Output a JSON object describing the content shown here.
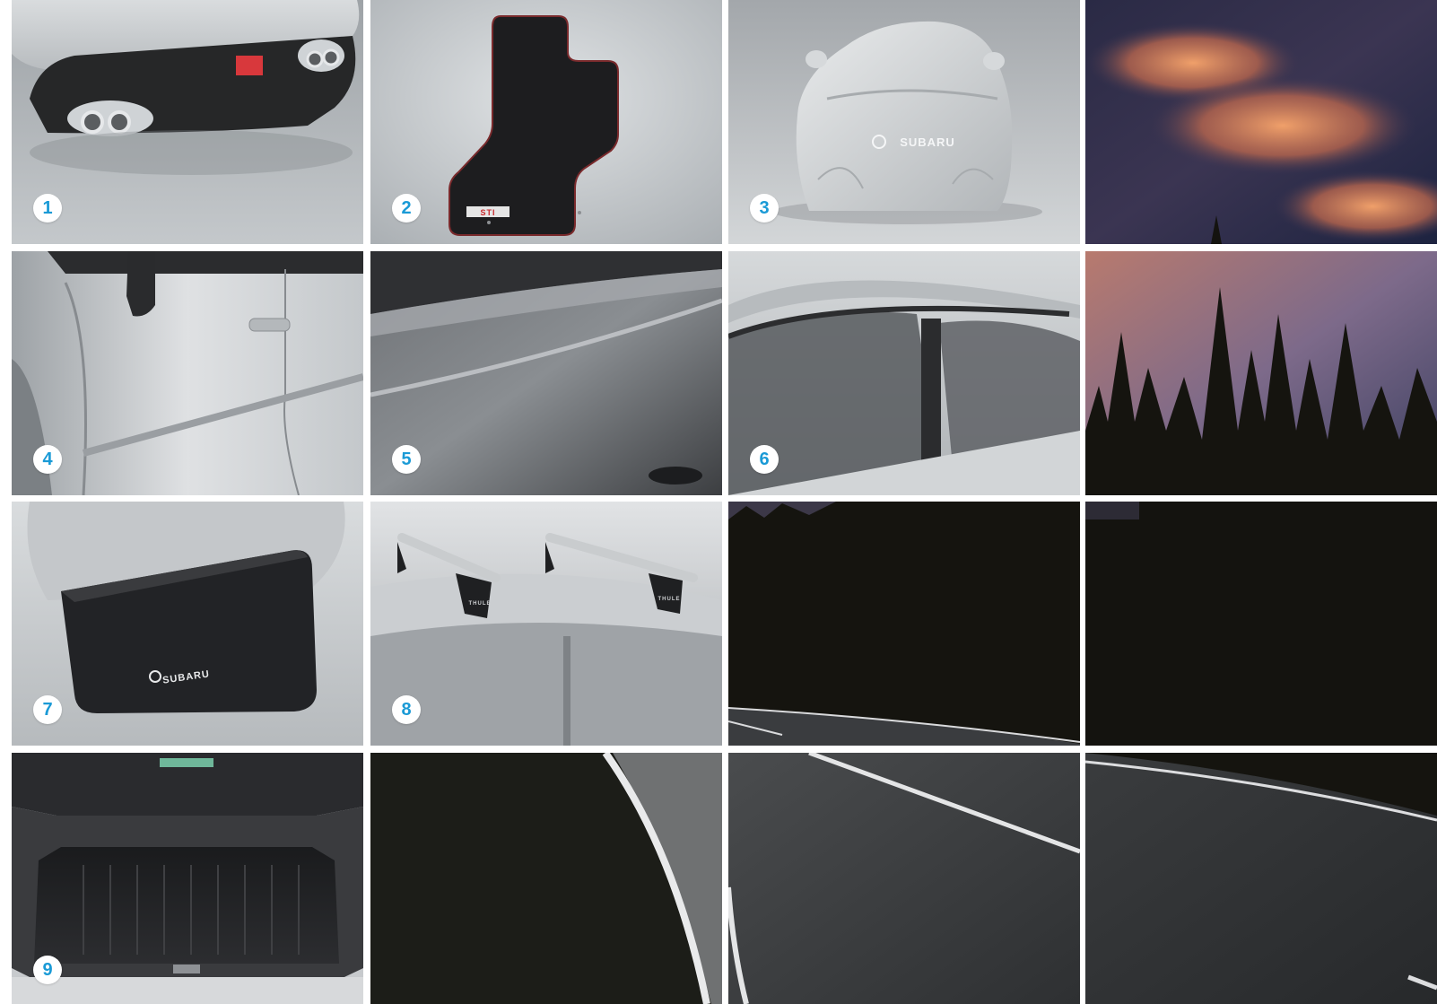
{
  "brand": {
    "accent_color": "#1a9ad6",
    "cover_logo_text": "SUBARU",
    "fender_cover_logo_text": "SUBARU",
    "mat_badge_text": "STI",
    "roof_rack_label": "THULE"
  },
  "accessories": [
    {
      "number": "1",
      "icon": "rear-diffuser-exhaust-image"
    },
    {
      "number": "2",
      "icon": "floor-mat-image"
    },
    {
      "number": "3",
      "icon": "car-cover-image"
    },
    {
      "number": "4",
      "icon": "side-body-moulding-image"
    },
    {
      "number": "5",
      "icon": "rear-bumper-protector-image"
    },
    {
      "number": "6",
      "icon": "weathershields-image"
    },
    {
      "number": "7",
      "icon": "fender-cover-image"
    },
    {
      "number": "8",
      "icon": "roof-rack-image"
    },
    {
      "number": "9",
      "icon": "cargo-tray-image"
    }
  ],
  "scenery": [
    "sunset-sky-image",
    "forest-road-image"
  ],
  "colors": {
    "badge_bg": "#ffffff",
    "studio_gray": "#a8adb1",
    "night_dark": "#14130f"
  }
}
